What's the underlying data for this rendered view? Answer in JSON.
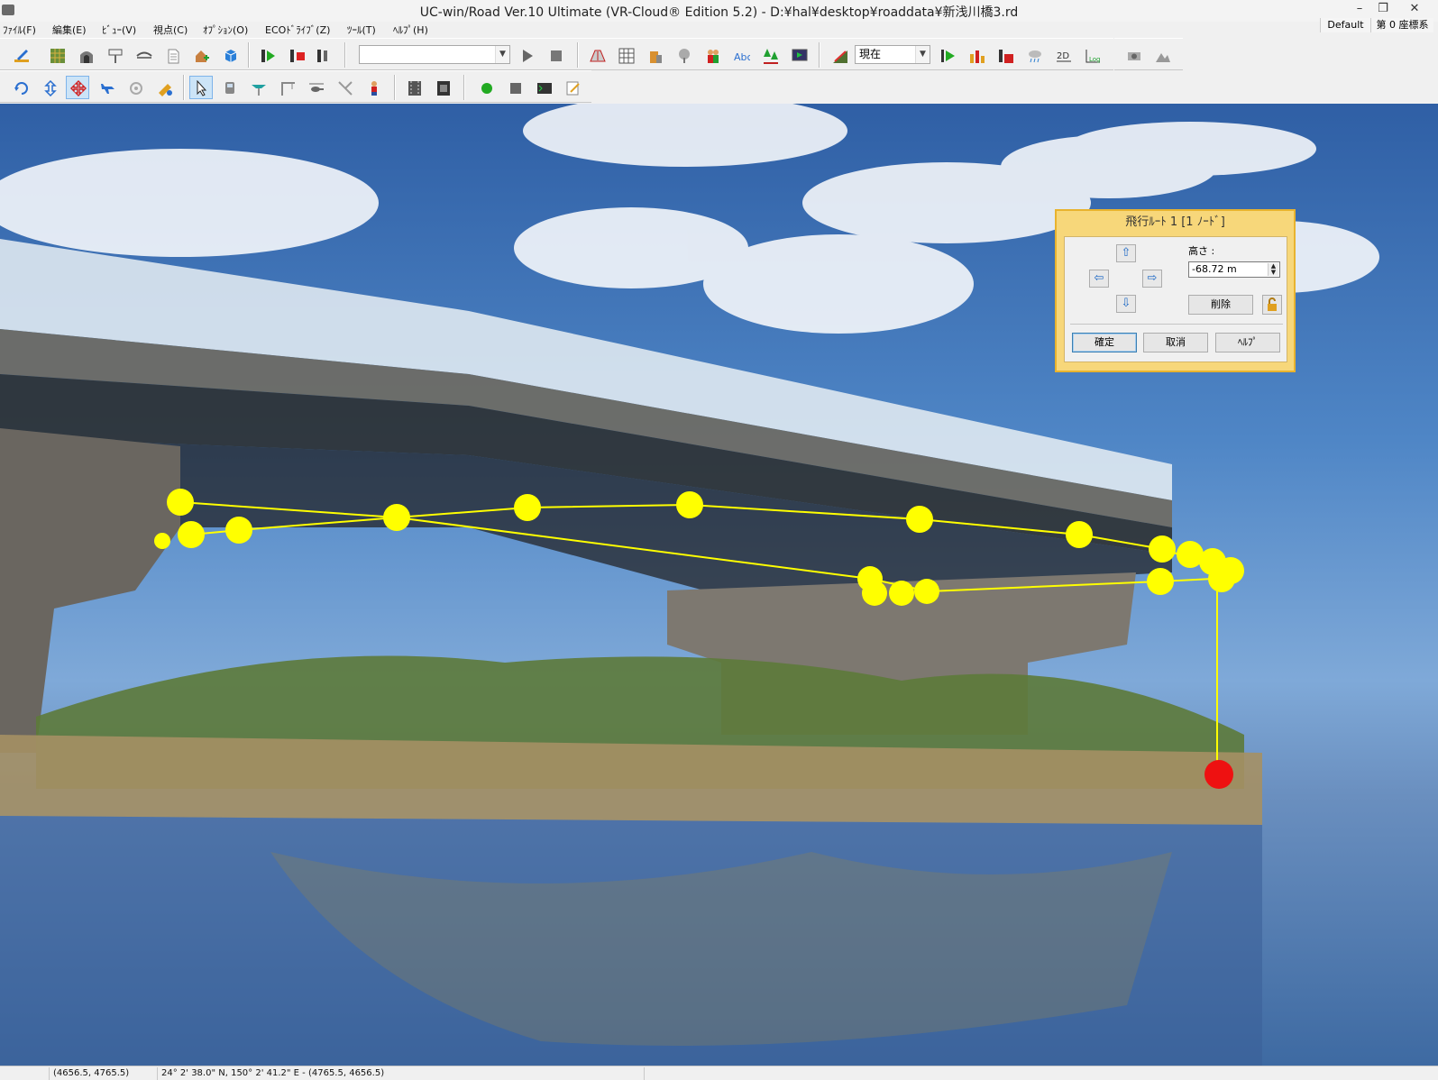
{
  "window": {
    "title": "UC-win/Road Ver.10 Ultimate (VR-Cloud® Edition 5.2) - D:¥hal¥desktop¥roaddata¥新浅川橋3.rd",
    "minimize": "–",
    "restore": "❐",
    "close": "✕"
  },
  "menu": {
    "items": [
      {
        "label": "ﾌｧｲﾙ(F)"
      },
      {
        "label": "編集(E)"
      },
      {
        "label": "ﾋﾞｭｰ(V)"
      },
      {
        "label": "視点(C)"
      },
      {
        "label": "ｵﾌﾟｼｮﾝ(O)"
      },
      {
        "label": "ECOﾄﾞﾗｲﾌﾞ(Z)"
      },
      {
        "label": "ﾂｰﾙ(T)"
      },
      {
        "label": "ﾍﾙﾌﾟ(H)"
      }
    ],
    "preset": "Default",
    "coordinate_system": "第 0 座標系"
  },
  "toolbar": {
    "scenario_combo_value": "",
    "time_combo_value": "現在",
    "dropdown_arrow": "▼",
    "icons_row1": [
      "edit-road-icon",
      "terrain-icon",
      "tunnel-icon",
      "sign-icon",
      "bridge-icon",
      "document-icon",
      "house-add-icon",
      "model-icon",
      "play-scenario-icon",
      "stop-scenario-icon",
      "record-icon",
      "play-icon",
      "stop-icon",
      "road-section-icon",
      "table-icon",
      "building-icon",
      "tree-model-icon",
      "people-icon",
      "text-abc-icon",
      "forest-icon",
      "screen-icon",
      "slope-icon",
      "play-green-icon",
      "bar-chart-icon",
      "record-red-icon",
      "weather-icon",
      "view-2d-icon",
      "log-icon",
      "camera-icon",
      "scene-icon"
    ],
    "icons_row2": [
      "rotate-icon",
      "updown-icon",
      "move-cross-icon",
      "fly-plane-icon",
      "orbit-icon",
      "measure-icon",
      "select-arrow-icon",
      "vehicle-icon",
      "flight-route-icon",
      "crane-icon",
      "helicopter-icon",
      "road-edit-icon",
      "person-icon",
      "film-icon",
      "film-dark-icon",
      "green-dot-icon",
      "square-icon",
      "terminal-icon",
      "script-icon"
    ]
  },
  "dialog": {
    "title": "飛行ﾙｰﾄ 1 [1 ﾉｰﾄﾞ]",
    "height_label": "高さ :",
    "height_value": "-68.72 m",
    "up": "⇧",
    "down": "⇩",
    "left": "⇦",
    "right": "⇨",
    "delete": "削除",
    "ok": "確定",
    "cancel": "取消",
    "help": "ﾍﾙﾌﾟ",
    "spin_up": "▲",
    "spin_down": "▼"
  },
  "statusbar": {
    "cell1": "",
    "cell2": "(4656.5, 4765.5)",
    "cell3": "24°   2' 38.0\" N, 150°   2' 41.2\" E  -  (4765.5, 4656.5)",
    "cell4": ""
  }
}
